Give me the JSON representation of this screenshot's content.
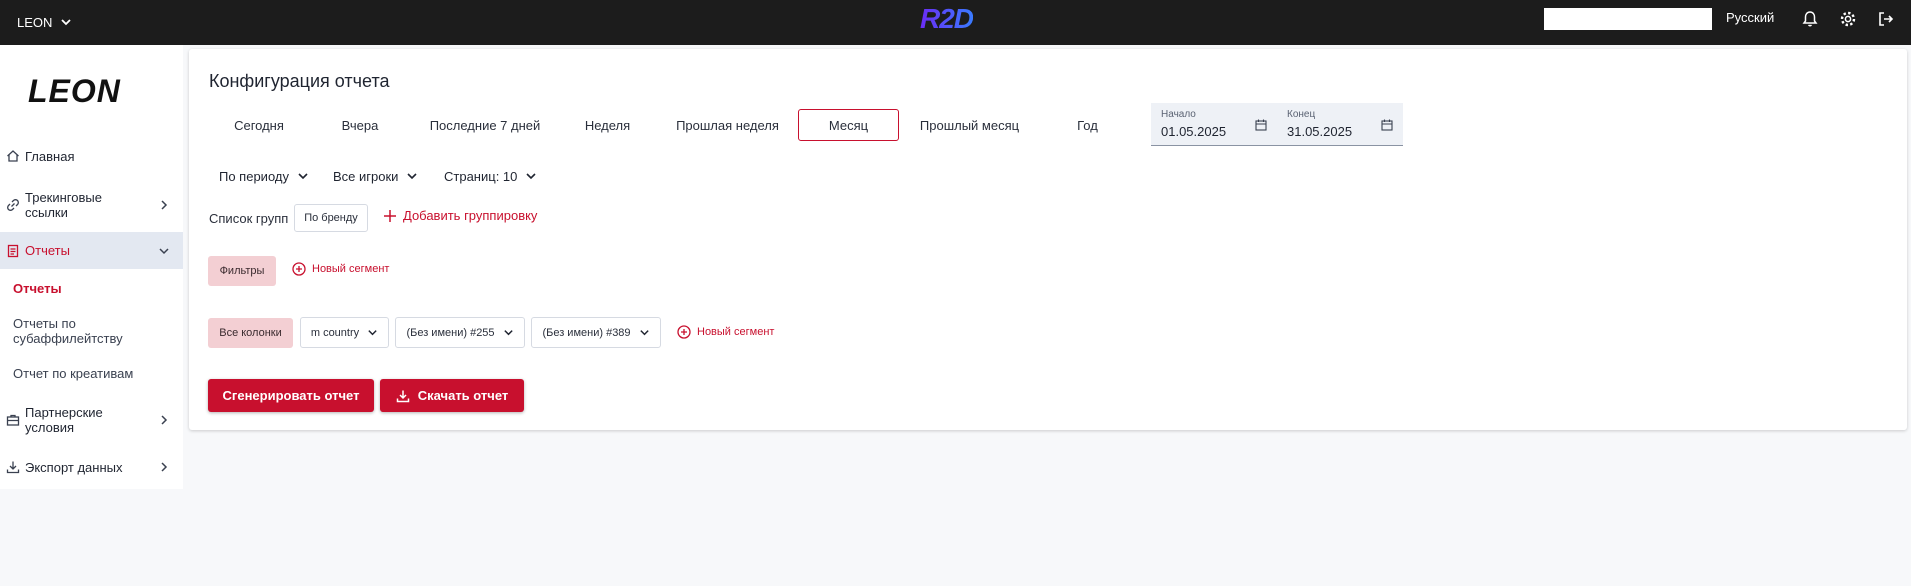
{
  "topbar": {
    "brand": "LEON",
    "app_logo": "R2D",
    "search_value": "",
    "language": "Русский",
    "icons": [
      "bell-icon",
      "gear-icon",
      "logout-icon"
    ]
  },
  "sidebar": {
    "logo": "LEON",
    "items": [
      {
        "label": "Главная",
        "icon": "home-icon"
      },
      {
        "label": "Трекинговые ссылки",
        "icon": "link-icon"
      },
      {
        "label": "Отчеты",
        "icon": "document-icon"
      },
      {
        "label": "Партнерские условия",
        "icon": "briefcase-icon"
      },
      {
        "label": "Экспорт данных",
        "icon": "download-icon"
      }
    ],
    "subitems": [
      {
        "label": "Отчеты"
      },
      {
        "label": "Отчеты по субаффилейтству"
      },
      {
        "label": "Отчет по креативам"
      }
    ]
  },
  "main": {
    "title": "Конфигурация отчета",
    "periods": [
      "Сегодня",
      "Вчера",
      "Последние 7 дней",
      "Неделя",
      "Прошлая неделя",
      "Месяц",
      "Прошлый месяц",
      "Год"
    ],
    "selected_period": "Месяц",
    "start": {
      "label": "Начало",
      "value": "01.05.2025"
    },
    "end": {
      "label": "Конец",
      "value": "31.05.2025"
    },
    "dropdowns": [
      "По периоду",
      "Все игроки",
      "Страниц: 10"
    ],
    "group_label": "Список групп",
    "group_chip": "По бренду",
    "add_grouping": "Добавить группировку",
    "filters_label": "Фильтры",
    "new_segment": "Новый сегмент",
    "columns_label": "Все колонки",
    "column_selects": [
      "m country",
      "(Без имени) #255",
      "(Без имени) #389"
    ],
    "new_segment_2": "Новый сегмент",
    "generate_btn": "Сгенерировать отчет",
    "download_btn": "Скачать отчет"
  },
  "colors": {
    "accent": "#c8102e",
    "topbar": "#1c1c1c",
    "active_bg": "#e3e8f1",
    "pink": "#f3cfd3"
  }
}
